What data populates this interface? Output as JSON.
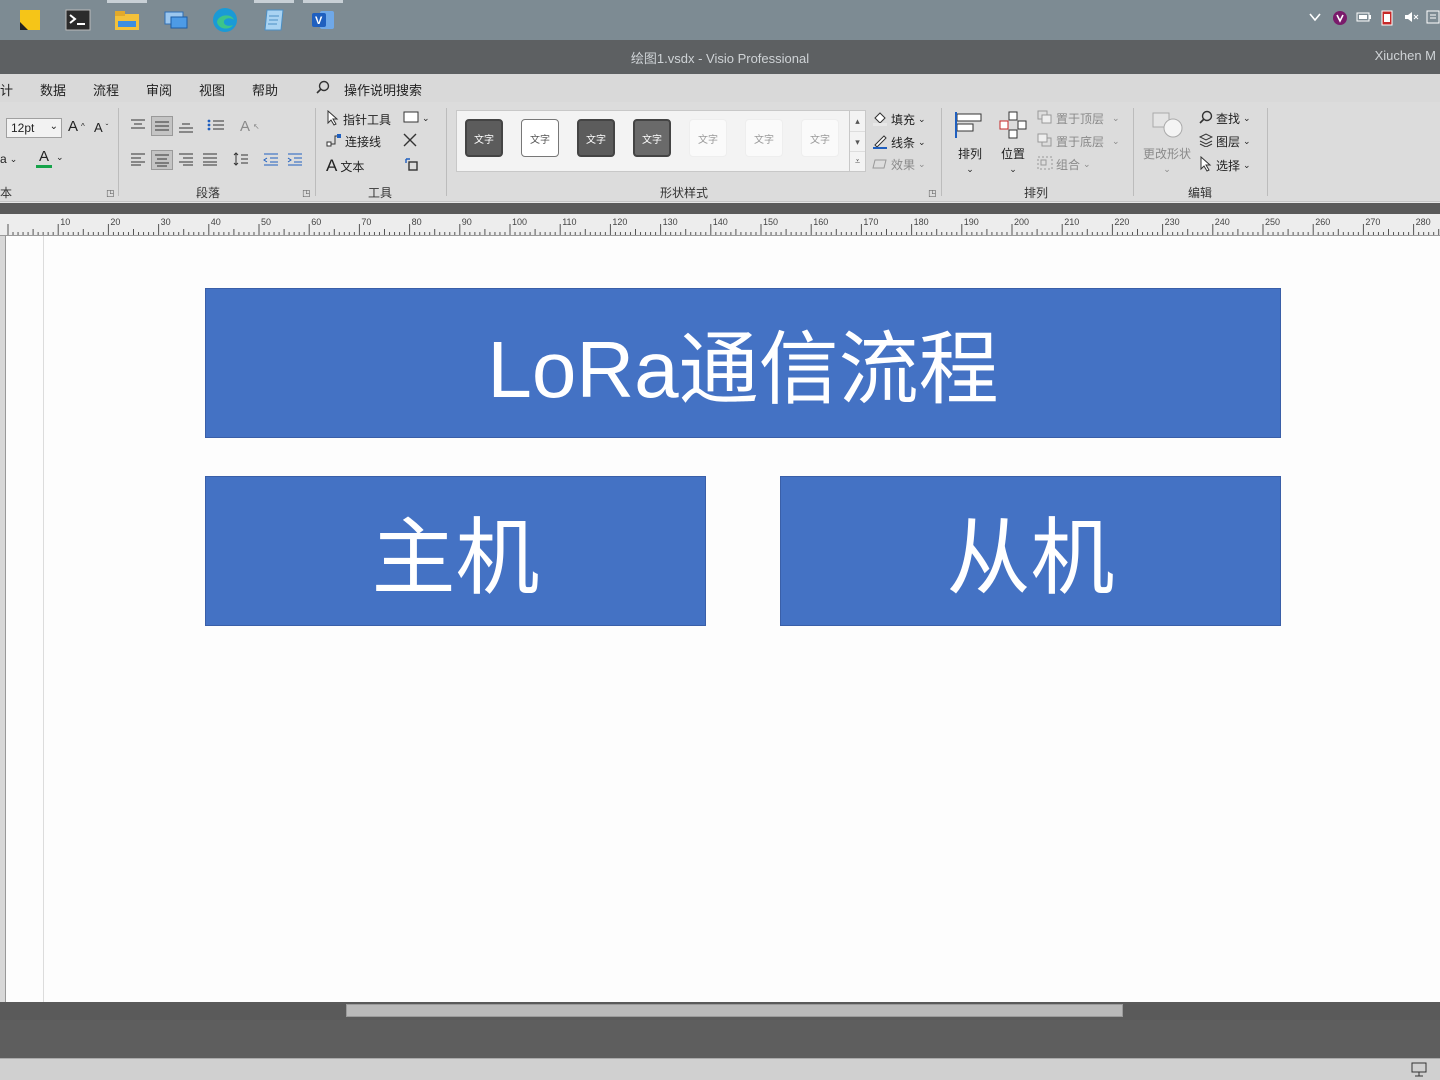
{
  "taskbar": {
    "icons": [
      "sticky-notes-icon",
      "terminal-icon",
      "file-explorer-icon",
      "remote-desktop-icon",
      "edge-icon",
      "notepad-icon",
      "visio-icon"
    ],
    "tray": [
      "chevron-up-icon",
      "vivaldi-icon",
      "battery-icon",
      "film-icon",
      "mute-icon",
      "notifications-icon"
    ]
  },
  "window": {
    "title": "绘图1.vsdx  -  Visio Professional",
    "user": "Xiuchen M"
  },
  "menu": {
    "items": [
      "计",
      "数据",
      "流程",
      "审阅",
      "视图",
      "帮助"
    ],
    "search_label": "操作说明搜索"
  },
  "ribbon": {
    "font": {
      "size": "12pt",
      "label_fragment": "a",
      "font_color_label": "A",
      "group_label_fragment": "本"
    },
    "paragraph": {
      "group_label": "段落"
    },
    "tools": {
      "pointer": "指针工具",
      "connector": "连接线",
      "text": "文本",
      "group_label": "工具"
    },
    "shape_styles": {
      "swatches": [
        "文字",
        "文字",
        "文字",
        "文字",
        "文字",
        "文字",
        "文字"
      ],
      "fill": "填充",
      "line": "线条",
      "effect": "效果",
      "group_label": "形状样式"
    },
    "arrange": {
      "arrange": "排列",
      "position": "位置",
      "bring_front": "置于顶层",
      "send_back": "置于底层",
      "group": "组合",
      "group_label": "排列"
    },
    "editing": {
      "change_shape": "更改形状",
      "find": "查找",
      "layers": "图层",
      "select": "选择",
      "group_label": "编辑"
    }
  },
  "ruler": {
    "labels": [
      "10",
      "20",
      "30",
      "40",
      "50",
      "60",
      "70",
      "80",
      "90",
      "100",
      "110",
      "120",
      "130",
      "140",
      "150",
      "160",
      "170",
      "180",
      "190",
      "200",
      "210",
      "220",
      "230",
      "240",
      "250",
      "260",
      "270",
      "280"
    ]
  },
  "diagram": {
    "title": "LoRa通信流程",
    "host": "主机",
    "slave": "从机",
    "fill_color": "#4472c4"
  }
}
